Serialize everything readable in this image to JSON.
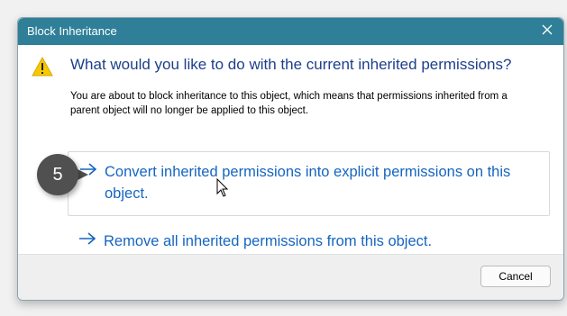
{
  "dialog": {
    "title": "Block Inheritance",
    "heading": "What would you like to do with the current inherited permissions?",
    "description": "You are about to block inheritance to this object, which means that permissions inherited from a parent object will no longer be applied to this object.",
    "options": [
      {
        "label": "Convert inherited permissions into explicit permissions on this object.",
        "icon": "arrow-right-icon"
      },
      {
        "label": "Remove all inherited permissions from this object.",
        "icon": "arrow-right-icon"
      }
    ],
    "cancel_label": "Cancel",
    "warning_icon": "warning-icon",
    "close_icon": "close-icon"
  },
  "annotation": {
    "step_number": "5"
  },
  "colors": {
    "titlebar": "#2f7f98",
    "heading": "#1e3f8b",
    "link": "#1565c0",
    "badge": "#505050"
  }
}
